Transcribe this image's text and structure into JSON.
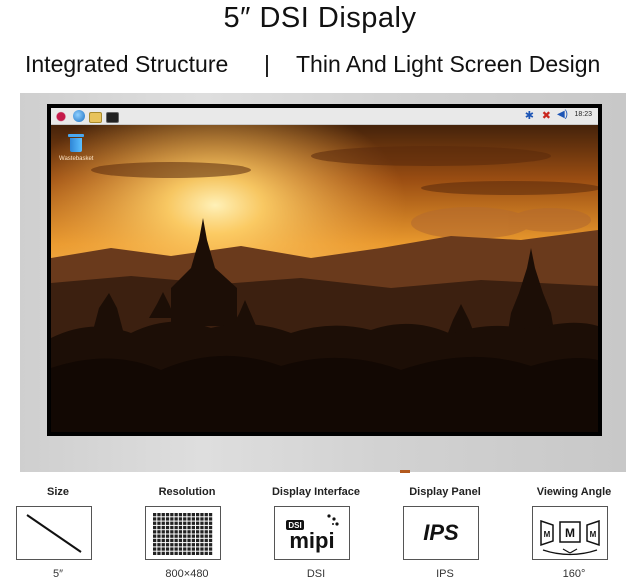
{
  "title": "5″ DSI Dispaly",
  "subtitle": {
    "left": "Integrated Structure",
    "separator": "|",
    "right": "Thin And Light Screen Design"
  },
  "desktop": {
    "taskbar": {
      "icons": [
        "raspberry-menu-icon",
        "browser-globe-icon",
        "file-manager-icon",
        "terminal-icon"
      ],
      "tray": {
        "bluetooth": "✱",
        "network": "✖",
        "volume": "◀)",
        "clock": "18:23"
      }
    },
    "trash": {
      "icon": "wastebasket-icon",
      "label": "Wastebasket"
    }
  },
  "features": [
    {
      "label": "Size",
      "icon": "diagonal-size-icon",
      "value": "5″"
    },
    {
      "label": "Resolution",
      "icon": "pixel-grid-icon",
      "value": "800×480"
    },
    {
      "label": "Display Interface",
      "icon": "dsi-mipi-logo",
      "logo_text_small": "DSI",
      "logo_text_big": "mipi",
      "value": "DSI"
    },
    {
      "label": "Display Panel",
      "icon": "ips-icon",
      "panel_text": "IPS",
      "value": "IPS"
    },
    {
      "label": "Viewing Angle",
      "icon": "viewing-angle-icon",
      "glyph": "M",
      "value": "160°"
    }
  ],
  "colors": {
    "bezel": "#d6d6d6",
    "accent": "#b35a1f",
    "sky_top": "#3a2010",
    "sun": "#ffd36b"
  }
}
